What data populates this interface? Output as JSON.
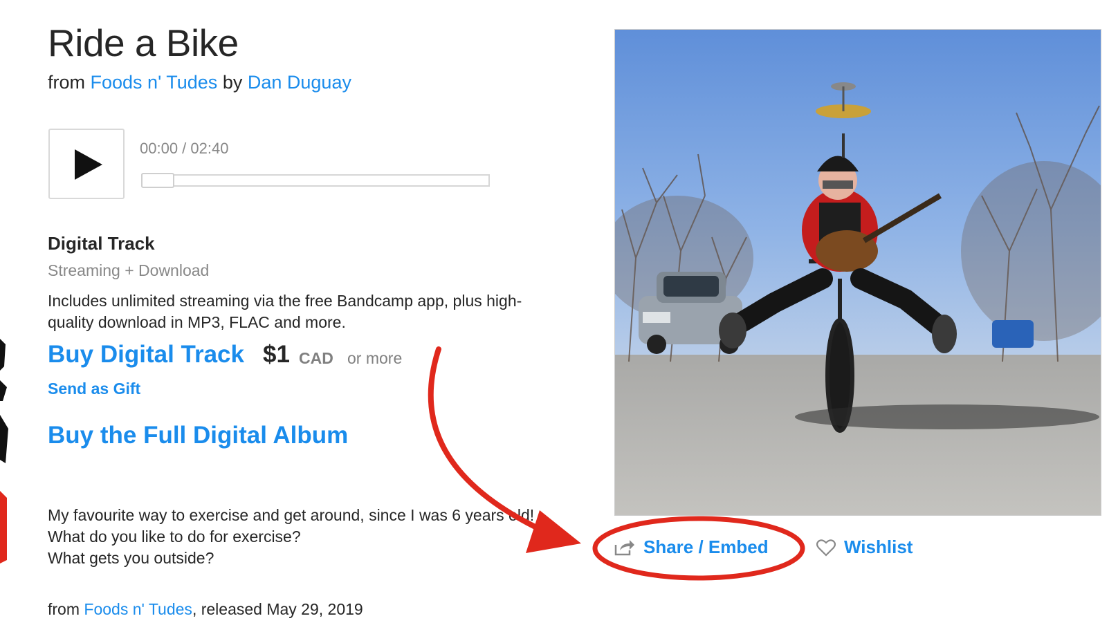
{
  "track": {
    "title": "Ride a Bike",
    "from_prefix": "from",
    "album": "Foods n' Tudes",
    "by_prefix": "by",
    "artist": "Dan Duguay"
  },
  "player": {
    "time": "00:00 / 02:40",
    "progress": 0
  },
  "digital": {
    "label": "Digital Track",
    "sub": "Streaming + Download",
    "description_line1": "Includes unlimited streaming via the free Bandcamp app, plus high-",
    "description_line2": "quality download in MP3, FLAC and more.",
    "buy_label": "Buy Digital Track",
    "price": "$1",
    "currency": "CAD",
    "or_more": "or more",
    "gift_label": "Send as Gift",
    "buy_album_label": "Buy the Full Digital Album"
  },
  "about": {
    "line1": "My favourite way to exercise and get around, since I was 6 years old!",
    "line2": "What do you like to do for exercise?",
    "line3": "What gets you outside?"
  },
  "release": {
    "from_prefix": "from",
    "album": "Foods n' Tudes",
    "suffix": ", released May 29, 2019"
  },
  "actions": {
    "share_label": "Share / Embed",
    "wishlist_label": "Wishlist"
  },
  "colors": {
    "link": "#1a8cec",
    "annotation": "#e0281c"
  }
}
